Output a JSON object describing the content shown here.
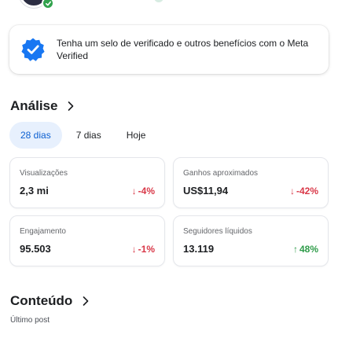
{
  "banner": {
    "text": "Tenha um selo de verificado e outros benefícios com o Meta Verified"
  },
  "analysis": {
    "title": "Análise",
    "tabs": [
      {
        "label": "28 dias",
        "active": true
      },
      {
        "label": "7 dias",
        "active": false
      },
      {
        "label": "Hoje",
        "active": false
      }
    ],
    "metrics": [
      {
        "name": "Visualizações",
        "value": "2,3 mi",
        "delta": "-4%",
        "trend": "down",
        "arrow": "↓"
      },
      {
        "name": "Ganhos aproximados",
        "value": "US$11,94",
        "delta": "-42%",
        "trend": "down",
        "arrow": "↓"
      },
      {
        "name": "Engajamento",
        "value": "95.503",
        "delta": "-1%",
        "trend": "down",
        "arrow": "↓"
      },
      {
        "name": "Seguidores líquidos",
        "value": "13.119",
        "delta": "48%",
        "trend": "up",
        "arrow": "↑"
      }
    ]
  },
  "content": {
    "title": "Conteúdo",
    "subtitle": "Último post"
  },
  "colors": {
    "accent": "#0b5fd1",
    "down": "#d93848",
    "up": "#2f9c4a",
    "verified": "#1877f2"
  }
}
